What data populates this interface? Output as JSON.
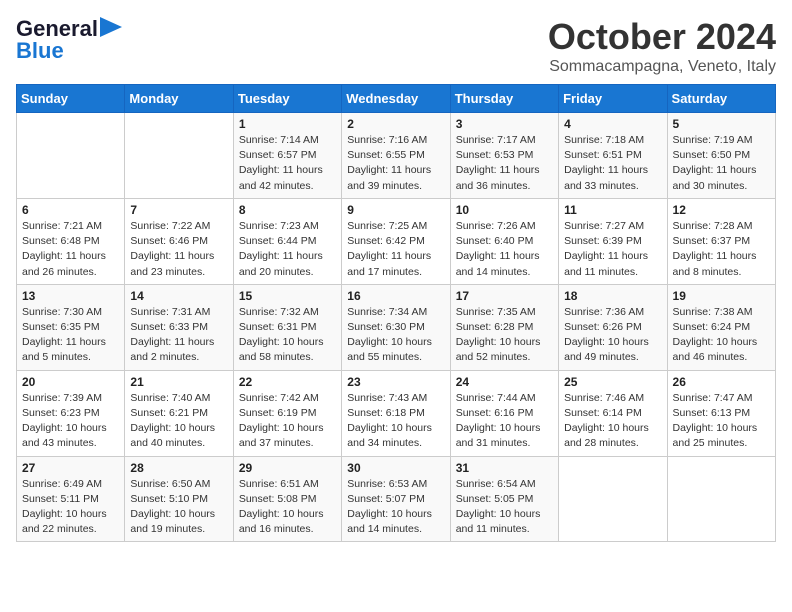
{
  "header": {
    "logo_line1": "General",
    "logo_line2": "Blue",
    "month": "October 2024",
    "location": "Sommacampagna, Veneto, Italy"
  },
  "days_of_week": [
    "Sunday",
    "Monday",
    "Tuesday",
    "Wednesday",
    "Thursday",
    "Friday",
    "Saturday"
  ],
  "weeks": [
    [
      {
        "day": "",
        "info": ""
      },
      {
        "day": "",
        "info": ""
      },
      {
        "day": "1",
        "info": "Sunrise: 7:14 AM\nSunset: 6:57 PM\nDaylight: 11 hours and 42 minutes."
      },
      {
        "day": "2",
        "info": "Sunrise: 7:16 AM\nSunset: 6:55 PM\nDaylight: 11 hours and 39 minutes."
      },
      {
        "day": "3",
        "info": "Sunrise: 7:17 AM\nSunset: 6:53 PM\nDaylight: 11 hours and 36 minutes."
      },
      {
        "day": "4",
        "info": "Sunrise: 7:18 AM\nSunset: 6:51 PM\nDaylight: 11 hours and 33 minutes."
      },
      {
        "day": "5",
        "info": "Sunrise: 7:19 AM\nSunset: 6:50 PM\nDaylight: 11 hours and 30 minutes."
      }
    ],
    [
      {
        "day": "6",
        "info": "Sunrise: 7:21 AM\nSunset: 6:48 PM\nDaylight: 11 hours and 26 minutes."
      },
      {
        "day": "7",
        "info": "Sunrise: 7:22 AM\nSunset: 6:46 PM\nDaylight: 11 hours and 23 minutes."
      },
      {
        "day": "8",
        "info": "Sunrise: 7:23 AM\nSunset: 6:44 PM\nDaylight: 11 hours and 20 minutes."
      },
      {
        "day": "9",
        "info": "Sunrise: 7:25 AM\nSunset: 6:42 PM\nDaylight: 11 hours and 17 minutes."
      },
      {
        "day": "10",
        "info": "Sunrise: 7:26 AM\nSunset: 6:40 PM\nDaylight: 11 hours and 14 minutes."
      },
      {
        "day": "11",
        "info": "Sunrise: 7:27 AM\nSunset: 6:39 PM\nDaylight: 11 hours and 11 minutes."
      },
      {
        "day": "12",
        "info": "Sunrise: 7:28 AM\nSunset: 6:37 PM\nDaylight: 11 hours and 8 minutes."
      }
    ],
    [
      {
        "day": "13",
        "info": "Sunrise: 7:30 AM\nSunset: 6:35 PM\nDaylight: 11 hours and 5 minutes."
      },
      {
        "day": "14",
        "info": "Sunrise: 7:31 AM\nSunset: 6:33 PM\nDaylight: 11 hours and 2 minutes."
      },
      {
        "day": "15",
        "info": "Sunrise: 7:32 AM\nSunset: 6:31 PM\nDaylight: 10 hours and 58 minutes."
      },
      {
        "day": "16",
        "info": "Sunrise: 7:34 AM\nSunset: 6:30 PM\nDaylight: 10 hours and 55 minutes."
      },
      {
        "day": "17",
        "info": "Sunrise: 7:35 AM\nSunset: 6:28 PM\nDaylight: 10 hours and 52 minutes."
      },
      {
        "day": "18",
        "info": "Sunrise: 7:36 AM\nSunset: 6:26 PM\nDaylight: 10 hours and 49 minutes."
      },
      {
        "day": "19",
        "info": "Sunrise: 7:38 AM\nSunset: 6:24 PM\nDaylight: 10 hours and 46 minutes."
      }
    ],
    [
      {
        "day": "20",
        "info": "Sunrise: 7:39 AM\nSunset: 6:23 PM\nDaylight: 10 hours and 43 minutes."
      },
      {
        "day": "21",
        "info": "Sunrise: 7:40 AM\nSunset: 6:21 PM\nDaylight: 10 hours and 40 minutes."
      },
      {
        "day": "22",
        "info": "Sunrise: 7:42 AM\nSunset: 6:19 PM\nDaylight: 10 hours and 37 minutes."
      },
      {
        "day": "23",
        "info": "Sunrise: 7:43 AM\nSunset: 6:18 PM\nDaylight: 10 hours and 34 minutes."
      },
      {
        "day": "24",
        "info": "Sunrise: 7:44 AM\nSunset: 6:16 PM\nDaylight: 10 hours and 31 minutes."
      },
      {
        "day": "25",
        "info": "Sunrise: 7:46 AM\nSunset: 6:14 PM\nDaylight: 10 hours and 28 minutes."
      },
      {
        "day": "26",
        "info": "Sunrise: 7:47 AM\nSunset: 6:13 PM\nDaylight: 10 hours and 25 minutes."
      }
    ],
    [
      {
        "day": "27",
        "info": "Sunrise: 6:49 AM\nSunset: 5:11 PM\nDaylight: 10 hours and 22 minutes."
      },
      {
        "day": "28",
        "info": "Sunrise: 6:50 AM\nSunset: 5:10 PM\nDaylight: 10 hours and 19 minutes."
      },
      {
        "day": "29",
        "info": "Sunrise: 6:51 AM\nSunset: 5:08 PM\nDaylight: 10 hours and 16 minutes."
      },
      {
        "day": "30",
        "info": "Sunrise: 6:53 AM\nSunset: 5:07 PM\nDaylight: 10 hours and 14 minutes."
      },
      {
        "day": "31",
        "info": "Sunrise: 6:54 AM\nSunset: 5:05 PM\nDaylight: 10 hours and 11 minutes."
      },
      {
        "day": "",
        "info": ""
      },
      {
        "day": "",
        "info": ""
      }
    ]
  ]
}
